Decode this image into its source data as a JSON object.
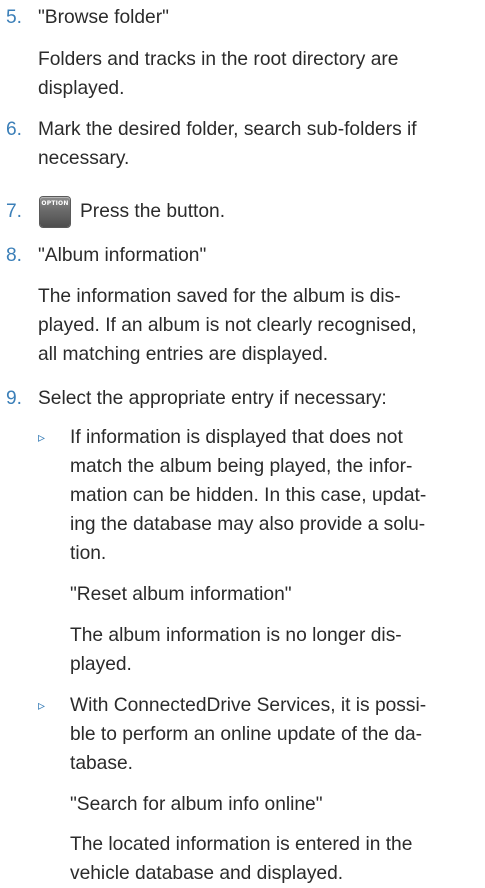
{
  "steps": [
    {
      "num": "5.",
      "text": "\"Browse folder\""
    },
    {
      "num": "6.",
      "text": "Mark the desired folder, search sub-folders if"
    },
    {
      "num": "7.",
      "text": "Press the button."
    },
    {
      "num": "8.",
      "text": "\"Album information\""
    },
    {
      "num": "9.",
      "text": "Select the appropriate entry if necessary:"
    }
  ],
  "step5_desc": [
    "Folders and tracks in the root directory are",
    "displayed."
  ],
  "step6_cont": "necessary.",
  "option_icon_label": "OPTION",
  "step8_desc": [
    "The information saved for the album is dis-",
    "played. If an album is not clearly recognised,",
    "all matching entries are displayed."
  ],
  "bullet_marker": "▹",
  "bullets": [
    {
      "lines": [
        "If information is displayed that does not",
        "match the album being played, the infor-",
        "mation can be hidden. In this case, updat-",
        "ing the database may also provide a solu-",
        "tion."
      ],
      "menu": "\"Reset album information\"",
      "result": [
        "The album information is no longer dis-",
        "played."
      ]
    },
    {
      "lines": [
        "With ConnectedDrive Services, it is possi-",
        "ble to perform an online update of the da-",
        "tabase."
      ],
      "menu": "\"Search for album info online\"",
      "result": [
        "The located information is entered in the",
        "vehicle database and displayed."
      ]
    }
  ],
  "colors": {
    "accent": "#3b7fb8",
    "text": "#2b2b2b"
  }
}
